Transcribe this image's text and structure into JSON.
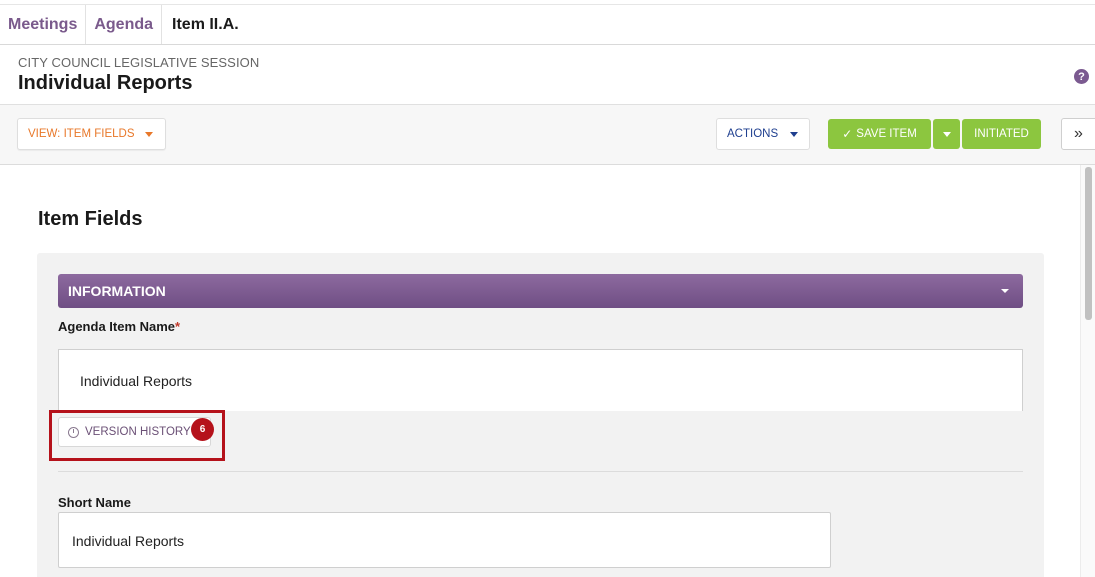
{
  "breadcrumb": [
    "Meetings",
    "Agenda",
    "Item II.A."
  ],
  "header": {
    "subtitle": "CITY COUNCIL LEGISLATIVE SESSION",
    "title": "Individual Reports",
    "help_glyph": "?"
  },
  "toolbar": {
    "view_label": "VIEW: ITEM FIELDS",
    "actions_label": "ACTIONS",
    "save_label": "SAVE ITEM",
    "status_label": "INITIATED",
    "expand_glyph": "»"
  },
  "main": {
    "section_title": "Item Fields",
    "info_header": "INFORMATION",
    "agenda_item_name_label": "Agenda Item Name",
    "required_marker": "*",
    "agenda_item_name_value": "Individual Reports",
    "version_history_label": "VERSION HISTORY",
    "version_history_count": "6",
    "short_name_label": "Short Name",
    "short_name_value": "Individual Reports"
  },
  "colors": {
    "accent_purple": "#7b5a90",
    "save_green": "#8cc63f",
    "view_orange": "#e8782a",
    "highlight_red": "#b5121b"
  },
  "icons": [
    "help-icon",
    "caret-down-icon",
    "checkmark-icon",
    "double-chevron-right-icon",
    "clock-history-icon"
  ]
}
